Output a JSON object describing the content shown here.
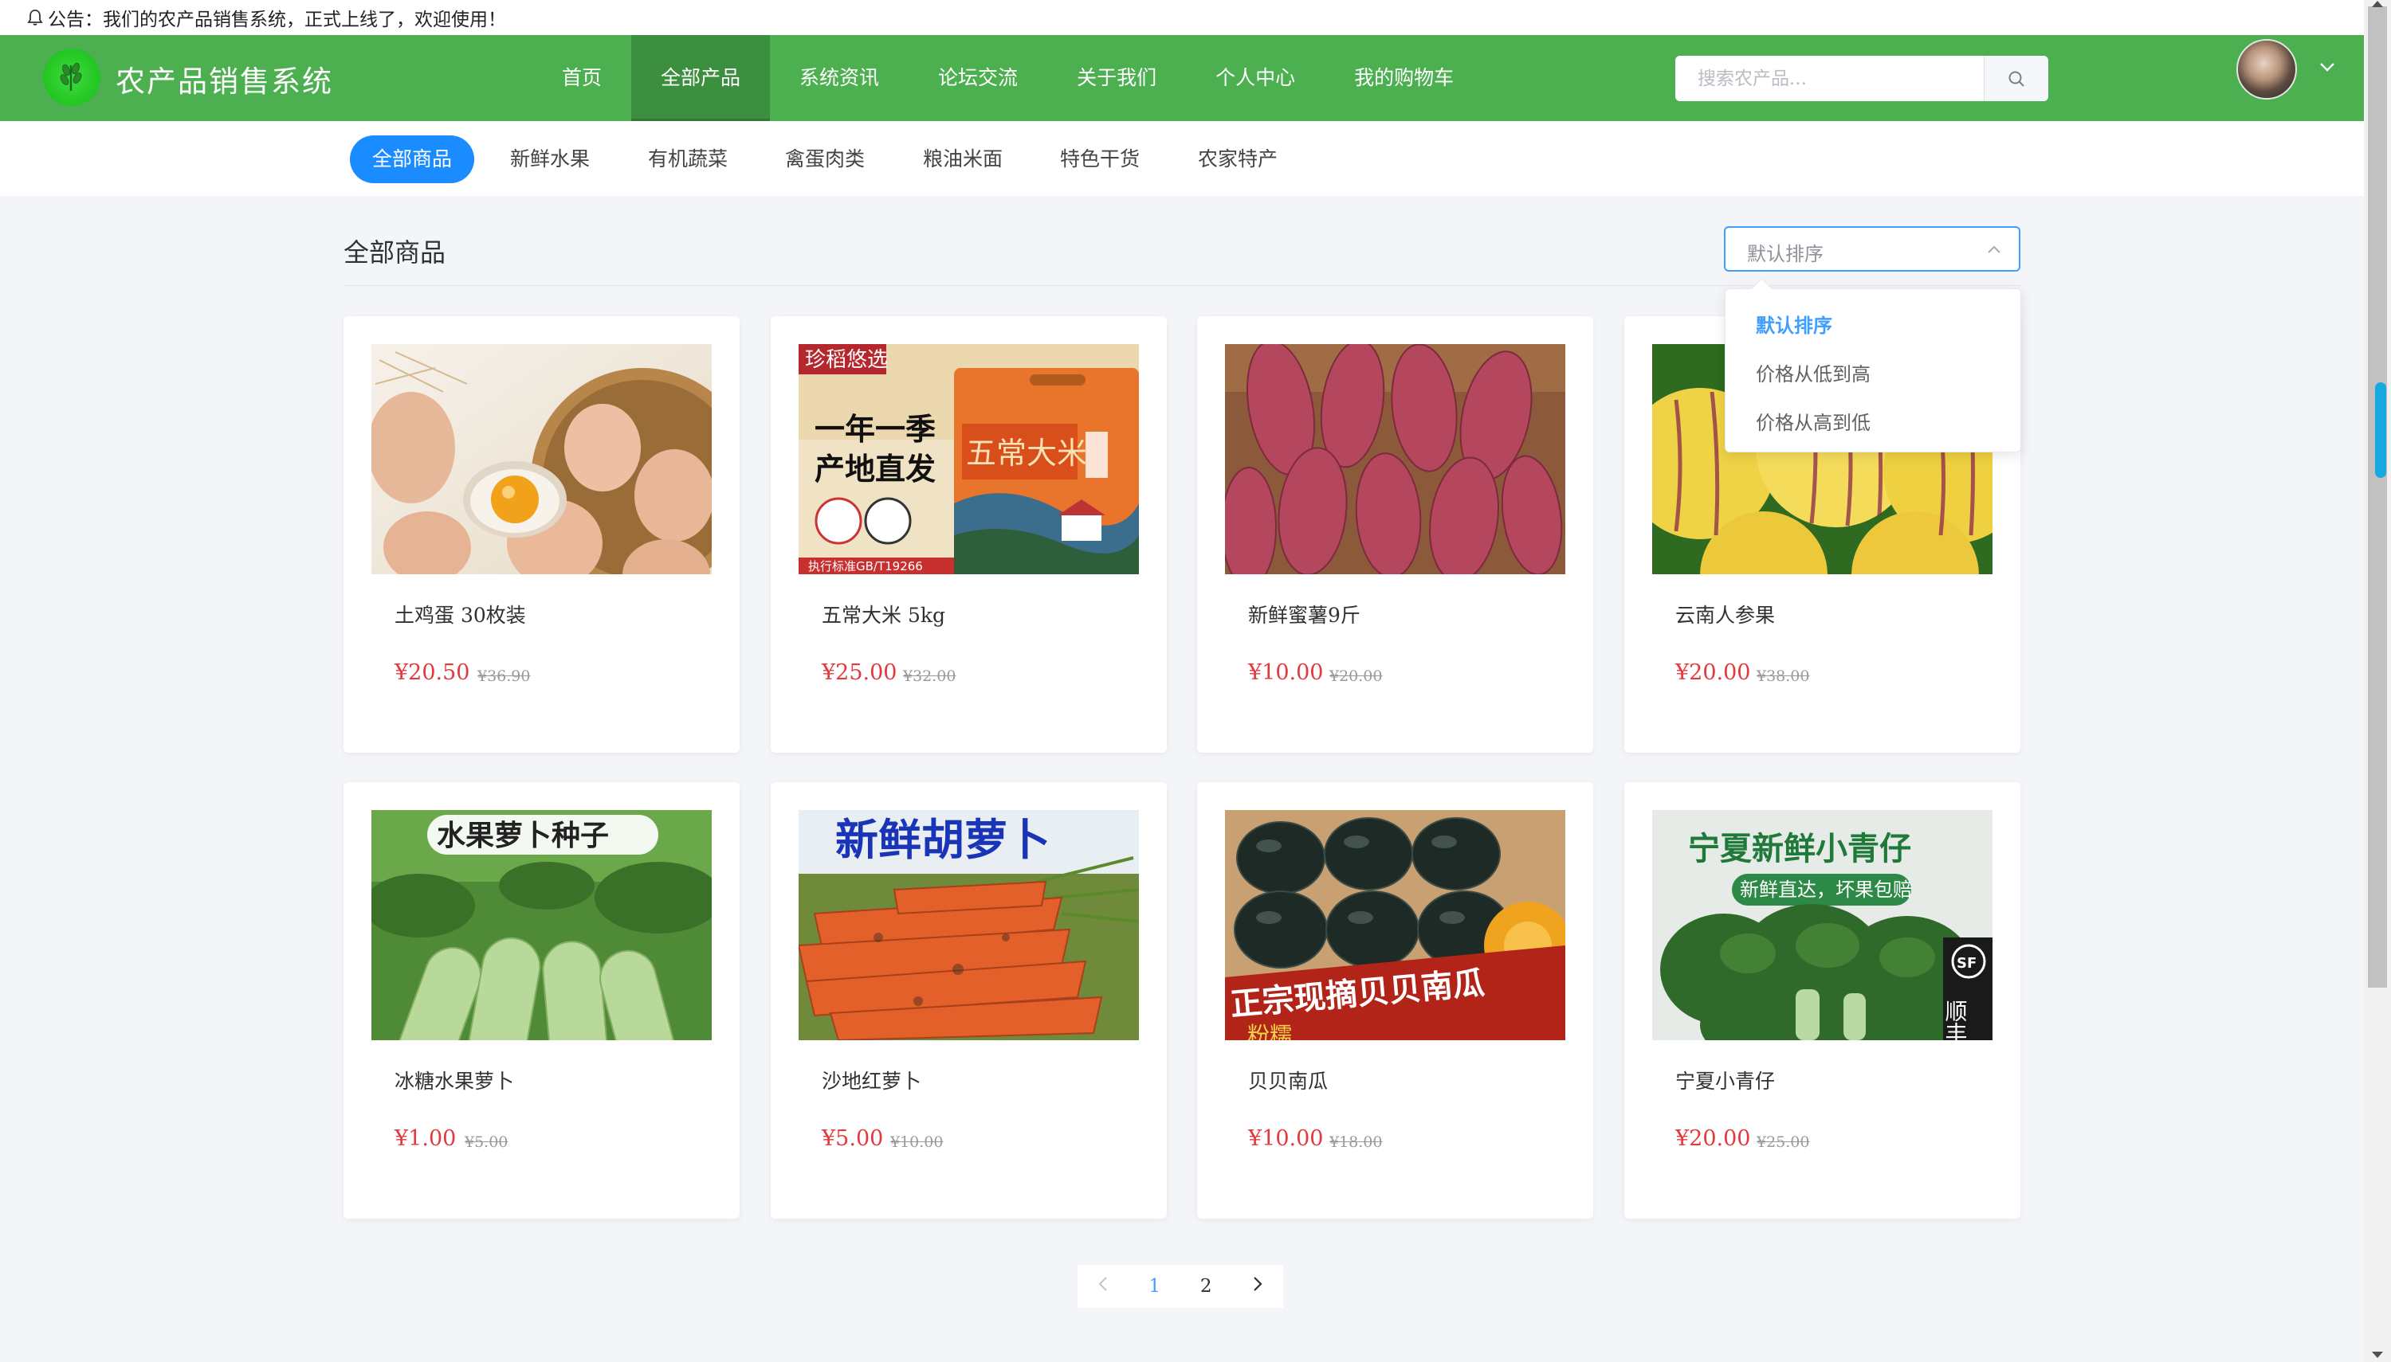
{
  "notice": {
    "text": "公告：我们的农产品销售系统，正式上线了，欢迎使用！"
  },
  "header": {
    "brand": "农产品销售系统",
    "nav": [
      "首页",
      "全部产品",
      "系统资讯",
      "论坛交流",
      "关于我们",
      "个人中心",
      "我的购物车"
    ],
    "active_nav": "全部产品",
    "search_placeholder": "搜索农产品..."
  },
  "categories": {
    "items": [
      "全部商品",
      "新鲜水果",
      "有机蔬菜",
      "禽蛋肉类",
      "粮油米面",
      "特色干货",
      "农家特产"
    ],
    "active": "全部商品"
  },
  "main": {
    "section_title": "全部商品",
    "sort": {
      "selected": "默认排序",
      "options": [
        "默认排序",
        "价格从低到高",
        "价格从高到低"
      ]
    }
  },
  "products": [
    {
      "name": "土鸡蛋 30枚装",
      "price": "¥20.50",
      "original_price": "¥36.90",
      "image": "eggs-photo"
    },
    {
      "name": "五常大米 5kg",
      "price": "¥25.00",
      "original_price": "¥32.00",
      "image": "rice-bag-photo",
      "image_text": {
        "badge": "珍稻悠选",
        "slogan1": "一年一季",
        "slogan2": "产地直发",
        "bag": "五常大米",
        "std": "执行标准GB/T19266"
      }
    },
    {
      "name": "新鲜蜜薯9斤",
      "price": "¥10.00",
      "original_price": "¥20.00",
      "image": "sweet-potato-photo"
    },
    {
      "name": "云南人参果",
      "price": "¥20.00",
      "original_price": "¥38.00",
      "image": "pepino-photo"
    },
    {
      "name": "冰糖水果萝卜",
      "price": "¥1.00",
      "original_price": "¥5.00",
      "image": "radish-photo",
      "image_text": {
        "banner": "水果萝卜种子"
      }
    },
    {
      "name": "沙地红萝卜",
      "price": "¥5.00",
      "original_price": "¥10.00",
      "image": "carrot-photo",
      "image_text": {
        "banner": "新鲜胡萝卜"
      }
    },
    {
      "name": "贝贝南瓜",
      "price": "¥10.00",
      "original_price": "¥18.00",
      "image": "pumpkin-photo",
      "image_text": {
        "banner": "正宗现摘贝贝南瓜",
        "sub": "粉糯"
      }
    },
    {
      "name": "宁夏小青仔",
      "price": "¥20.00",
      "original_price": "¥25.00",
      "image": "bok-choy-photo",
      "image_text": {
        "banner": "宁夏新鲜小青仔",
        "sub": "新鲜直达，坏果包赔",
        "sf": "顺丰包"
      }
    }
  ],
  "pagination": {
    "pages": [
      "1",
      "2"
    ],
    "current": "1"
  },
  "colors": {
    "header_green": "#4caf50",
    "active_blue": "#1a8cff",
    "price_red": "#e4393c"
  }
}
